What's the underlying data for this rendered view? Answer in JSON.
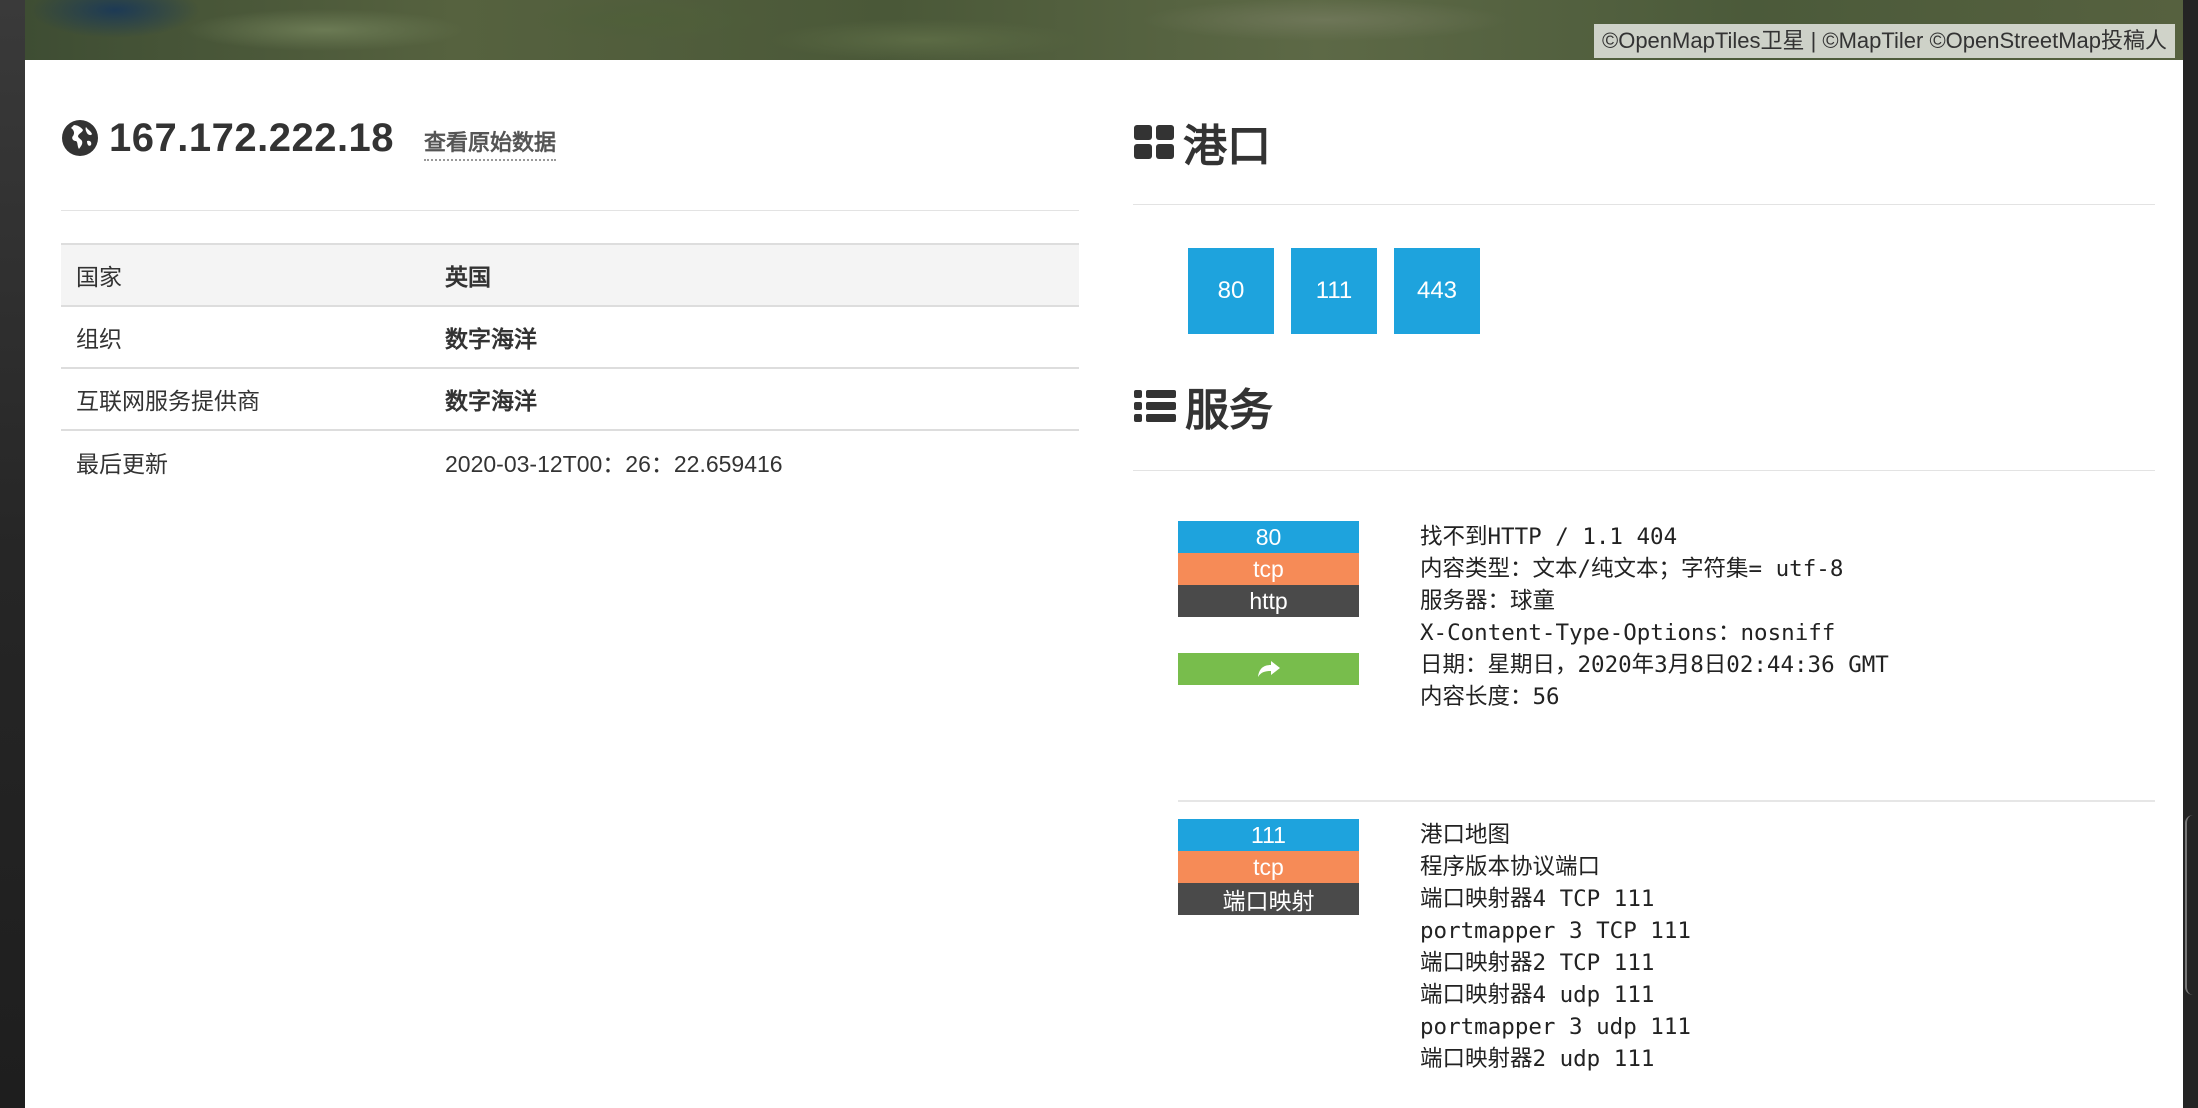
{
  "map": {
    "attribution": "©OpenMapTiles卫星 | ©MapTiler ©OpenStreetMap投稿人"
  },
  "host": {
    "ip": "167.172.222.18",
    "raw_data_link": "查看原始数据"
  },
  "info_table": [
    {
      "key": "国家",
      "value": "英国"
    },
    {
      "key": "组织",
      "value": "数字海洋"
    },
    {
      "key": "互联网服务提供商",
      "value": "数字海洋"
    },
    {
      "key": "最后更新",
      "value": "2020-03-12T00：26：22.659416"
    }
  ],
  "ports_section": {
    "title": "港口",
    "ports": [
      "80",
      "111",
      "443"
    ]
  },
  "services_section": {
    "title": "服务",
    "services": [
      {
        "port": "80",
        "protocol": "tcp",
        "name": "http",
        "banner": [
          "找不到HTTP / 1.1 404",
          "内容类型：文本/纯文本；字符集= utf-8",
          "服务器：球童",
          "X-Content-Type-Options：nosniff",
          "日期：星期日，2020年3月8日02:44:36 GMT",
          "内容长度：56"
        ]
      },
      {
        "port": "111",
        "protocol": "tcp",
        "name": "端口映射",
        "banner": [
          "港口地图",
          "程序版本协议端口",
          "端口映射器4 TCP 111",
          "portmapper 3 TCP 111",
          "端口映射器2 TCP 111",
          "端口映射器4 udp 111",
          "portmapper 3 udp 111",
          "端口映射器2 udp 111"
        ]
      }
    ]
  },
  "colors": {
    "port_badge": "#1ea3dd",
    "proto_badge": "#f68b57",
    "name_badge": "#4a4a4a",
    "redirect": "#78bd4c"
  },
  "icons": {
    "ip": "globe-icon",
    "ports": "th-large-icon",
    "services": "list-icon",
    "redirect": "share-arrow-icon"
  }
}
